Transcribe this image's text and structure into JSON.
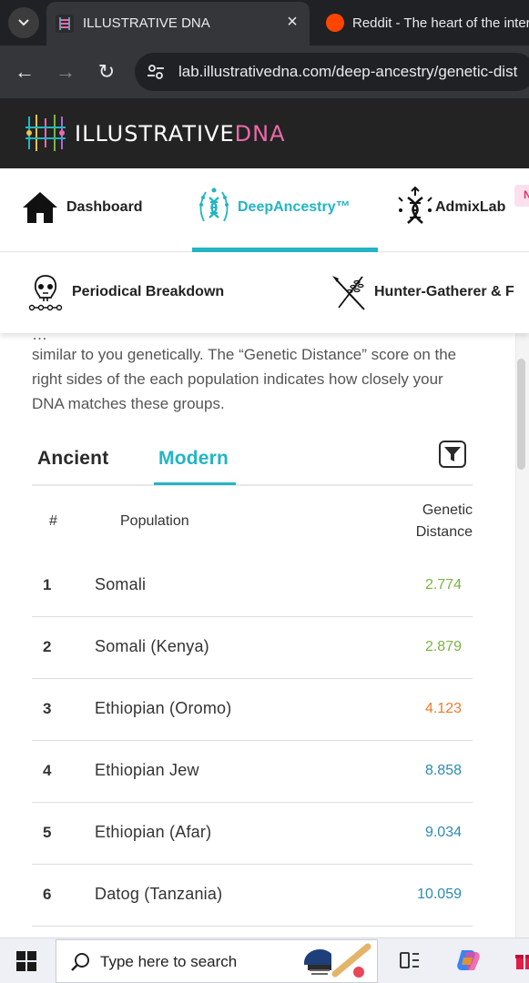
{
  "browser": {
    "tabs": [
      {
        "title": "ILLUSTRATIVE DNA",
        "active": true
      },
      {
        "title": "Reddit - The heart of the inter",
        "active": false
      }
    ],
    "url": "lab.illustrativedna.com/deep-ancestry/genetic-dist"
  },
  "site": {
    "logo_text_main": "ILLUSTRATIVE",
    "logo_text_accent": "DNA"
  },
  "main_nav": {
    "items": [
      {
        "label": "Dashboard",
        "icon": "home-icon"
      },
      {
        "label": "DeepAncestry™",
        "icon": "dna-laurel-icon",
        "active": true
      },
      {
        "label": "AdmixLab",
        "icon": "admix-dna-icon"
      }
    ],
    "badge": "N"
  },
  "sub_nav": {
    "items": [
      {
        "label": "Periodical Breakdown",
        "icon": "skull-timeline-icon"
      },
      {
        "label": "Hunter-Gatherer & F",
        "icon": "spear-wheat-icon"
      }
    ]
  },
  "content": {
    "description_cut": "…",
    "description": "similar to you genetically. The “Genetic Distance” score on the right sides of the each population indicates how closely your DNA matches these groups.",
    "tabs": {
      "ancient": "Ancient",
      "modern": "Modern"
    },
    "table": {
      "headers": {
        "rank": "#",
        "population": "Population",
        "distance_line1": "Genetic",
        "distance_line2": "Distance"
      },
      "rows": [
        {
          "rank": "1",
          "population": "Somali",
          "distance": "2.774",
          "color": "#7cb342"
        },
        {
          "rank": "2",
          "population": "Somali (Kenya)",
          "distance": "2.879",
          "color": "#7cb342"
        },
        {
          "rank": "3",
          "population": "Ethiopian (Oromo)",
          "distance": "4.123",
          "color": "#f07a2c"
        },
        {
          "rank": "4",
          "population": "Ethiopian Jew",
          "distance": "8.858",
          "color": "#2b8bb3"
        },
        {
          "rank": "5",
          "population": "Ethiopian (Afar)",
          "distance": "9.034",
          "color": "#2b8bb3"
        },
        {
          "rank": "6",
          "population": "Datog (Tanzania)",
          "distance": "10.059",
          "color": "#2b8bb3"
        }
      ]
    }
  },
  "taskbar": {
    "search_placeholder": "Type here to search"
  },
  "colors": {
    "accent": "#23b5c4",
    "header_bg": "#232323",
    "close_green": "#7cb342",
    "mid_orange": "#f07a2c",
    "far_blue": "#2b8bb3"
  }
}
